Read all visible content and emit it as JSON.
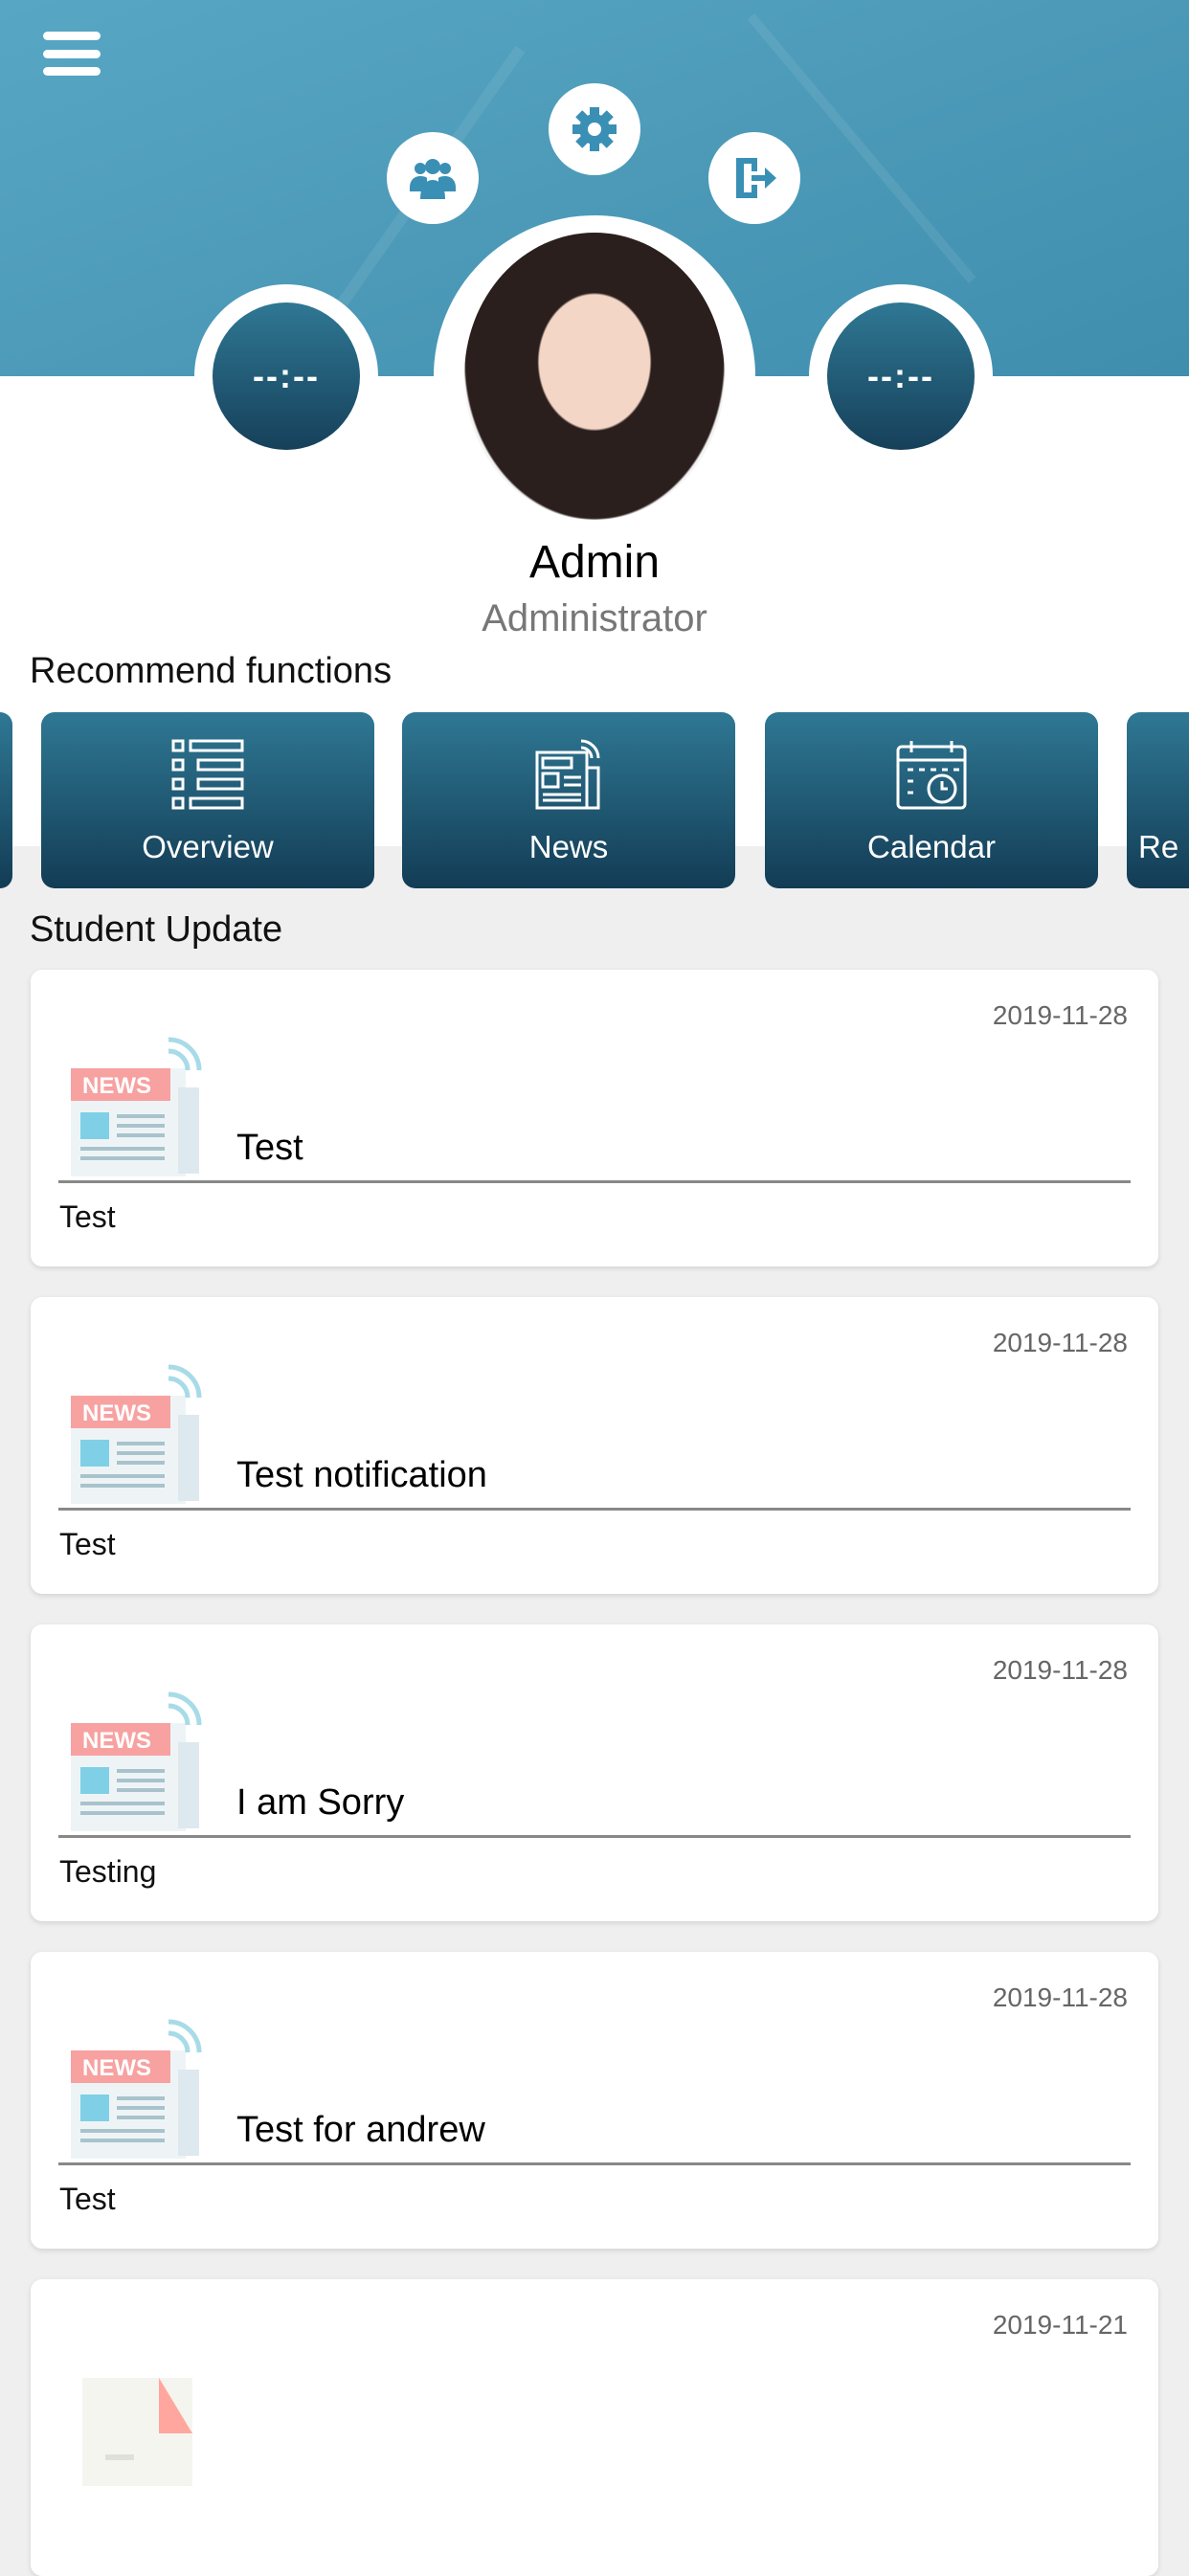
{
  "header": {
    "menu_icon": "hamburger-icon",
    "actions": [
      {
        "icon": "users-icon"
      },
      {
        "icon": "gear-icon"
      },
      {
        "icon": "logout-icon"
      }
    ],
    "left_time": "--:--",
    "right_time": "--:--"
  },
  "profile": {
    "name": "Admin",
    "role": "Administrator"
  },
  "recommend": {
    "title": "Recommend functions",
    "items": [
      {
        "label": "Overview",
        "icon": "list-icon"
      },
      {
        "label": "News",
        "icon": "newspaper-icon"
      },
      {
        "label": "Calendar",
        "icon": "calendar-icon"
      },
      {
        "label": "Re"
      }
    ]
  },
  "updates": {
    "title": "Student Update",
    "items": [
      {
        "date": "2019-11-28",
        "title": "Test",
        "body": "Test"
      },
      {
        "date": "2019-11-28",
        "title": "Test notification",
        "body": "Test"
      },
      {
        "date": "2019-11-28",
        "title": "I am Sorry",
        "body": "Testing"
      },
      {
        "date": "2019-11-28",
        "title": "Test for andrew",
        "body": "Test"
      },
      {
        "date": "2019-11-21",
        "title": "",
        "body": ""
      }
    ]
  },
  "colors": {
    "accent": "#1f5a76",
    "header_bg": "#4c9ab8",
    "page_bg": "#efefef"
  }
}
